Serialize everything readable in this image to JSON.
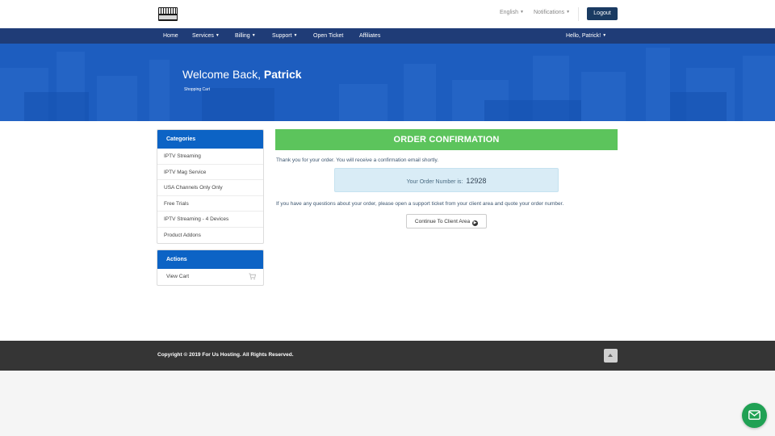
{
  "topbar": {
    "language_label": "English",
    "notifications_label": "Notifications",
    "logout_label": "Logout"
  },
  "nav": {
    "items": [
      {
        "label": "Home"
      },
      {
        "label": "Services"
      },
      {
        "label": "Billing"
      },
      {
        "label": "Support"
      },
      {
        "label": "Open Ticket"
      },
      {
        "label": "Affiliates"
      }
    ],
    "user_label": "Hello, Patrick!"
  },
  "hero": {
    "welcome_prefix": "Welcome Back,",
    "user_name": "Patrick",
    "breadcrumb": "Shopping Cart"
  },
  "categories": {
    "title": "Categories",
    "items": [
      {
        "label": "IPTV Streaming"
      },
      {
        "label": "IPTV Mag Service"
      },
      {
        "label": "USA Channels Only Only"
      },
      {
        "label": "Free Trials"
      },
      {
        "label": "IPTV Streaming - 4 Devices"
      },
      {
        "label": "Product Addons"
      }
    ]
  },
  "actions": {
    "title": "Actions",
    "items": [
      {
        "label": "View Cart",
        "icon": "shopping-cart-icon"
      }
    ]
  },
  "order": {
    "heading": "ORDER CONFIRMATION",
    "thanks_text": "Thank you for your order. You will receive a confirmation email shortly.",
    "order_number_label": "Your Order Number is:",
    "order_number": "12928",
    "questions_text": "If you have any questions about your order, please open a support ticket from your client area and quote your order number.",
    "continue_label": "Continue To Client Area"
  },
  "footer": {
    "copyright": "Copyright © 2019 For Us Hosting. All Rights Reserved."
  },
  "colors": {
    "navbar": "#1f3c77",
    "hero": "#1d5dbf",
    "panel_header": "#0c63c5",
    "order_header": "#5cc45c",
    "logout_button": "#1a3b62",
    "footer": "#353535",
    "message_button": "#20a154"
  }
}
